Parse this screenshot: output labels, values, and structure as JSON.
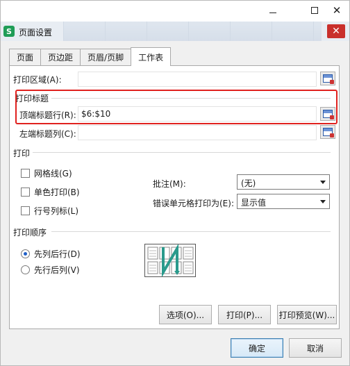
{
  "dialog": {
    "title": "页面设置",
    "app_icon": "S"
  },
  "tabs": [
    {
      "label": "页面"
    },
    {
      "label": "页边距"
    },
    {
      "label": "页眉/页脚"
    },
    {
      "label": "工作表"
    }
  ],
  "sheet": {
    "print_area_label": "打印区域(A):",
    "print_area_value": "",
    "print_titles_group": "打印标题",
    "title_rows_label": "顶端标题行(R):",
    "title_rows_value": "$6:$10",
    "title_cols_label": "左端标题列(C):",
    "title_cols_value": "",
    "print_group": "打印",
    "gridlines_label": "网格线(G)",
    "mono_label": "单色打印(B)",
    "headings_label": "行号列标(L)",
    "comments_label": "批注(M):",
    "comments_value": "(无)",
    "errors_label": "错误单元格打印为(E):",
    "errors_value": "显示值",
    "order_group": "打印顺序",
    "down_then_over_label": "先列后行(D)",
    "over_then_down_label": "先行后列(V)"
  },
  "buttons": {
    "options": "选项(O)...",
    "print": "打印(P)...",
    "preview": "打印预览(W)...",
    "ok": "确定",
    "cancel": "取消"
  },
  "colors": {
    "highlight": "#e0211e",
    "app_icon": "#1f9d57",
    "close": "#c9302c"
  }
}
